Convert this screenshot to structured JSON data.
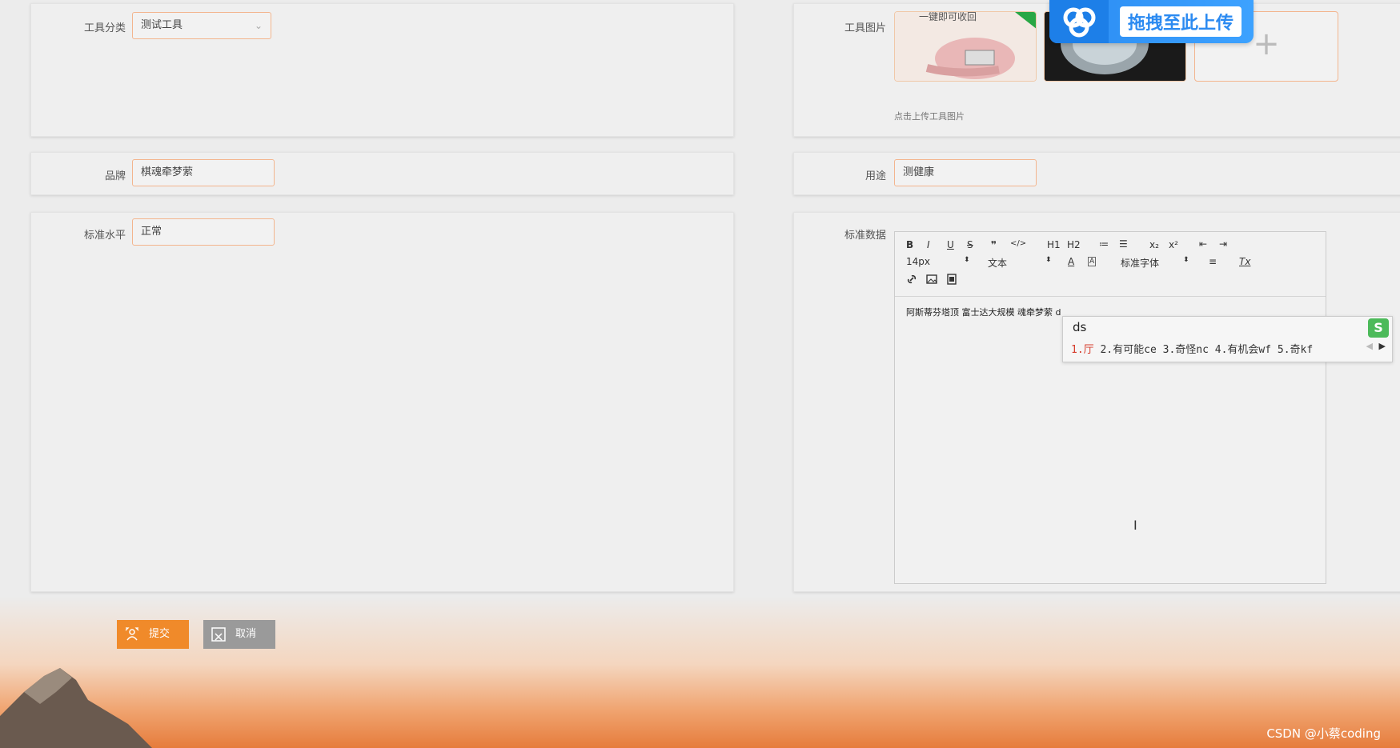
{
  "form": {
    "tool_category": {
      "label": "工具分类",
      "value": "测试工具"
    },
    "tool_image": {
      "label": "工具图片",
      "hint": "点击上传工具图片",
      "add_symbol": "+"
    },
    "brand": {
      "label": "品牌",
      "value": "棋魂牵梦萦"
    },
    "usage": {
      "label": "用途",
      "value": "测健康"
    },
    "standard_level": {
      "label": "标准水平",
      "value": "正常"
    },
    "standard_data": {
      "label": "标准数据"
    }
  },
  "thumb1_text": "一键即可收回",
  "baidu_overlay": {
    "text": "拖拽至此上传"
  },
  "editor": {
    "toolbar": {
      "row1": [
        "B",
        "I",
        "U",
        "S",
        "❞",
        "</>",
        "H1",
        "H2",
        "≔",
        "☰",
        "x₂",
        "x²",
        "⇤",
        "⇥"
      ],
      "font_size": "14px",
      "block": "文本",
      "font_color": "A",
      "bg_color": "A",
      "font_family": "标准字体",
      "align": "≡",
      "clear": "Tx",
      "row3": [
        "link",
        "image",
        "video"
      ]
    },
    "content": "阿斯蒂芬塔顶 富士达大规模 魂牵梦萦 d"
  },
  "ime": {
    "input": "ds",
    "candidates_first": "1.厅",
    "candidates_rest": " 2.有可能ce  3.奇怪nc  4.有机会wf  5.奇kf",
    "logo": "S"
  },
  "buttons": {
    "submit": "提交",
    "cancel": "取消"
  },
  "watermark": "CSDN @小蔡coding"
}
